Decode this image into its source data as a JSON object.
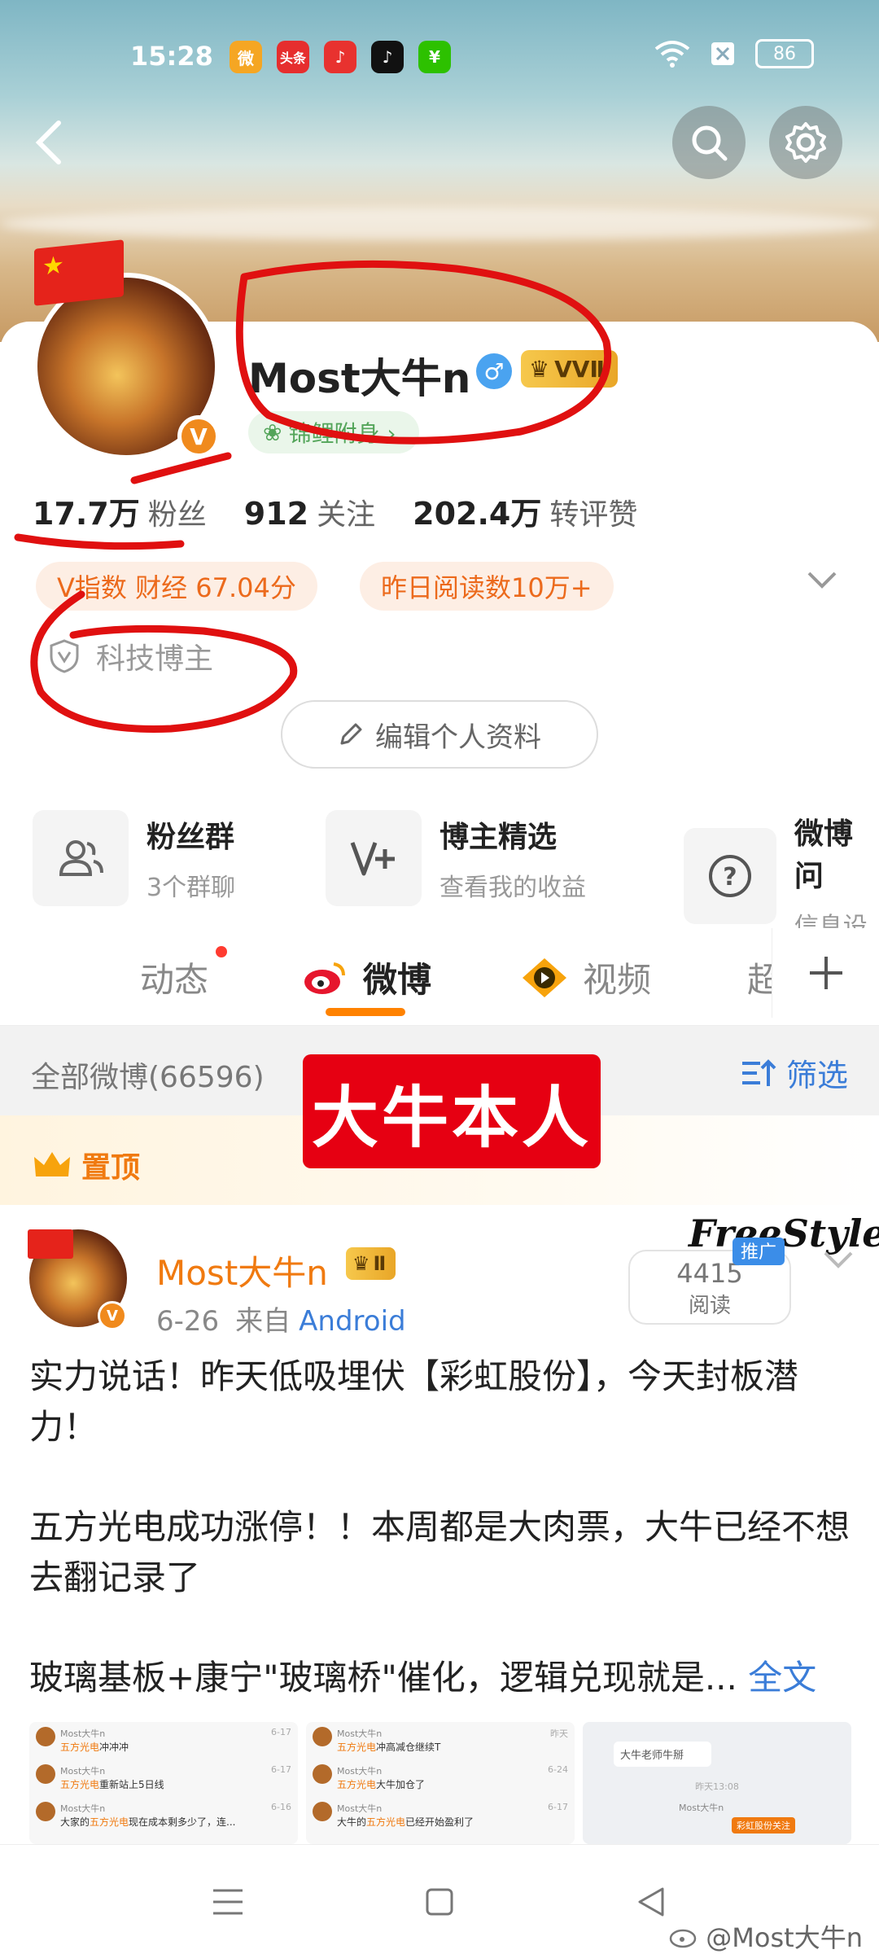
{
  "status_bar": {
    "time": "15:28",
    "apps": [
      {
        "name": "weibo-app-icon",
        "label": "微",
        "color": "#f5a623"
      },
      {
        "name": "toutiao-app-icon",
        "label": "头条",
        "color": "#e62e2e"
      },
      {
        "name": "music-app-icon",
        "label": "♪",
        "color": "#e8322f"
      },
      {
        "name": "tiktok-app-icon",
        "label": "♪",
        "color": "#111111"
      },
      {
        "name": "wechat-pay-app-icon",
        "label": "¥",
        "color": "#2dc100"
      }
    ],
    "battery": "86"
  },
  "profile": {
    "username": "Most大牛n",
    "gender_symbol": "♂",
    "vip_label": "VVⅡ",
    "medal_label": "锦鲤附身 ›",
    "stats": [
      {
        "value": "17.7万",
        "label": "粉丝"
      },
      {
        "value": "912",
        "label": "关注"
      },
      {
        "value": "202.4万",
        "label": "转评赞"
      }
    ],
    "pills": [
      "V指数 财经 67.04分",
      "昨日阅读数10万+"
    ],
    "tagline": "科技博主",
    "edit_button": "编辑个人资料"
  },
  "features": [
    {
      "title": "粉丝群",
      "subtitle": "3个群聊",
      "icon": "fans-group-icon"
    },
    {
      "title": "博主精选",
      "subtitle": "查看我的收益",
      "icon": "v-plus-icon"
    },
    {
      "title": "微博问",
      "subtitle": "信息设",
      "icon": "question-icon"
    }
  ],
  "tabs": [
    {
      "label": "动态",
      "active": false
    },
    {
      "label": "微博",
      "active": true
    },
    {
      "label": "视频",
      "active": false
    },
    {
      "label": "超",
      "active": false
    }
  ],
  "filter": {
    "all_posts": "全部微博(66596)",
    "filter_label": "筛选"
  },
  "banner_text": "大牛本人",
  "pinned_label": "置顶",
  "post": {
    "author": "Most大牛n",
    "vip_label": "Ⅱ",
    "date": "6-26",
    "source_prefix": "来自",
    "source": "Android",
    "reads": "4415",
    "reads_label": "阅读",
    "promo_label": "推广",
    "sticker_text": "FreeStyle",
    "paragraph1": "实力说话！昨天低吸埋伏【彩虹股份】，今天封板潜力！",
    "paragraph2": "五方光电成功涨停！！本周都是大肉票，大牛已经不想去翻记录了",
    "paragraph3": "玻璃基板+康宁\"玻璃桥\"催化，逻辑兑现就是...",
    "more_link": "全文"
  },
  "thumbs": {
    "col1": [
      {
        "name": "Most大牛n",
        "highlight": "五方光电",
        "rest": "冲冲冲",
        "date": "6-17"
      },
      {
        "name": "Most大牛n",
        "highlight": "五方光电",
        "rest": "重新站上5日线",
        "date": "6-17"
      },
      {
        "name": "Most大牛n",
        "highlight": "五方光电",
        "rest": "现在成本剩多少了，连...",
        "prefix": "大家的",
        "date": "6-16"
      }
    ],
    "col2": [
      {
        "name": "Most大牛n",
        "highlight": "五方光电",
        "rest": "冲高减仓继续T",
        "date": "昨天"
      },
      {
        "name": "Most大牛n",
        "highlight": "五方光电",
        "rest": "大牛加仓了",
        "date": "6-24"
      },
      {
        "name": "Most大牛n",
        "highlight": "五方光电",
        "rest": "已经开始盈利了",
        "prefix": "大牛的",
        "date": "6-17"
      }
    ],
    "col3": {
      "bubble": "大牛老师牛掰",
      "time": "昨天13:08",
      "name": "Most大牛n",
      "tag": "彩虹股份关注"
    }
  },
  "watermark": "@Most大牛n"
}
